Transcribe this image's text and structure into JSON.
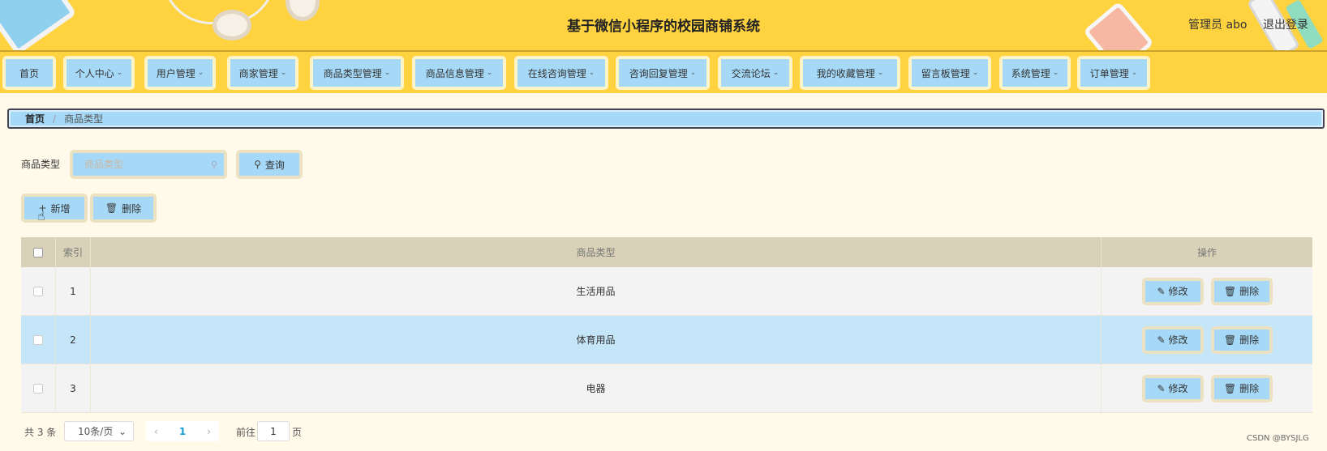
{
  "header": {
    "title": "基于微信小程序的校园商铺系统",
    "admin_label": "管理员 abo",
    "logout_label": "退出登录"
  },
  "nav": {
    "items": [
      {
        "label": "首页",
        "has_dropdown": false
      },
      {
        "label": "个人中心",
        "has_dropdown": true
      },
      {
        "label": "用户管理",
        "has_dropdown": true
      },
      {
        "label": "商家管理",
        "has_dropdown": true
      },
      {
        "label": "商品类型管理",
        "has_dropdown": true
      },
      {
        "label": "商品信息管理",
        "has_dropdown": true
      },
      {
        "label": "在线咨询管理",
        "has_dropdown": true
      },
      {
        "label": "咨询回复管理",
        "has_dropdown": true
      },
      {
        "label": "交流论坛",
        "has_dropdown": true
      },
      {
        "label": "我的收藏管理",
        "has_dropdown": true
      },
      {
        "label": "留言板管理",
        "has_dropdown": true
      },
      {
        "label": "系统管理",
        "has_dropdown": true
      },
      {
        "label": "订单管理",
        "has_dropdown": true
      }
    ],
    "chevron": "⌄"
  },
  "breadcrumb": {
    "home": "首页",
    "separator": "/",
    "current": "商品类型"
  },
  "search": {
    "label": "商品类型",
    "placeholder": "商品类型",
    "button_label": "查询"
  },
  "actions": {
    "add_label": "新增",
    "delete_label": "删除"
  },
  "table": {
    "headers": {
      "index": "索引",
      "type": "商品类型",
      "ops": "操作"
    },
    "rows": [
      {
        "index": "1",
        "type": "生活用品"
      },
      {
        "index": "2",
        "type": "体育用品"
      },
      {
        "index": "3",
        "type": "电器"
      }
    ],
    "row_edit_label": "修改",
    "row_delete_label": "删除"
  },
  "pagination": {
    "total": "共 3 条",
    "page_size": "10条/页",
    "current_page": "1",
    "goto_label": "前往",
    "goto_value": "1",
    "page_unit": "页"
  },
  "watermark": "CSDN @BYSJLG",
  "colors": {
    "header_bg": "#ffd23f",
    "button_bg": "#a6d9f7",
    "page_bg": "#fffaea",
    "highlight_row": "#c5e6f8"
  }
}
